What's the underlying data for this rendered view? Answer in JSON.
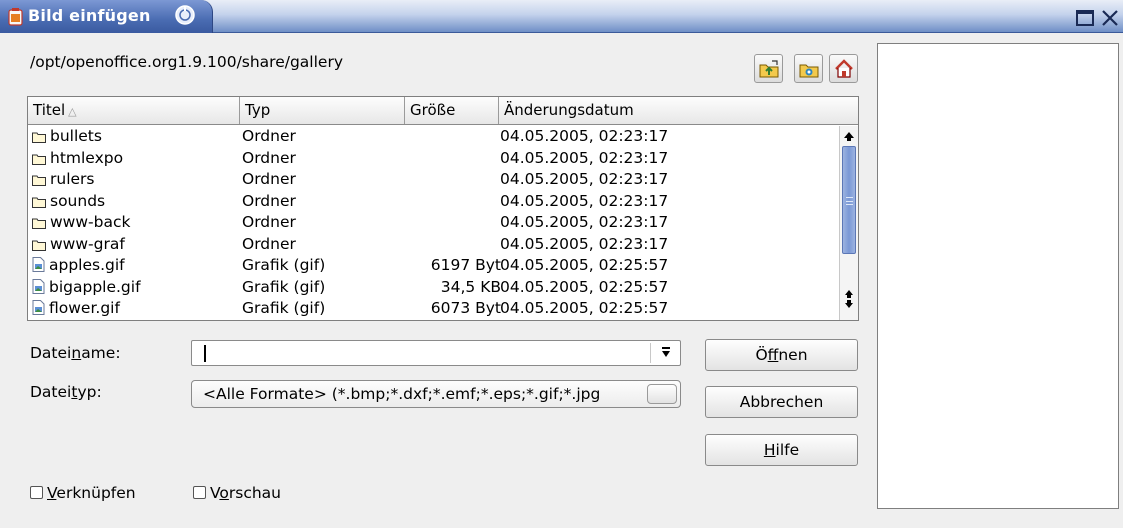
{
  "window": {
    "title": "Bild einfügen"
  },
  "path": "/opt/openoffice.org1.9.100/share/gallery",
  "toolbar": {
    "up_icon": "folder-up-icon",
    "new_folder_icon": "new-folder-icon",
    "home_icon": "home-icon"
  },
  "list": {
    "headers": {
      "title": "Titel",
      "type": "Typ",
      "size": "Größe",
      "date": "Änderungsdatum"
    },
    "rows": [
      {
        "name": "bullets",
        "type": "Ordner",
        "size": "",
        "date": "04.05.2005, 02:23:17",
        "kind": "folder"
      },
      {
        "name": "htmlexpo",
        "type": "Ordner",
        "size": "",
        "date": "04.05.2005, 02:23:17",
        "kind": "folder"
      },
      {
        "name": "rulers",
        "type": "Ordner",
        "size": "",
        "date": "04.05.2005, 02:23:17",
        "kind": "folder"
      },
      {
        "name": "sounds",
        "type": "Ordner",
        "size": "",
        "date": "04.05.2005, 02:23:17",
        "kind": "folder"
      },
      {
        "name": "www-back",
        "type": "Ordner",
        "size": "",
        "date": "04.05.2005, 02:23:17",
        "kind": "folder"
      },
      {
        "name": "www-graf",
        "type": "Ordner",
        "size": "",
        "date": "04.05.2005, 02:23:17",
        "kind": "folder"
      },
      {
        "name": "apples.gif",
        "type": "Grafik (gif)",
        "size": "6197 Byt",
        "date": "04.05.2005, 02:25:57",
        "kind": "file"
      },
      {
        "name": "bigapple.gif",
        "type": "Grafik (gif)",
        "size": "34,5 KB",
        "date": "04.05.2005, 02:25:57",
        "kind": "file"
      },
      {
        "name": "flower.gif",
        "type": "Grafik (gif)",
        "size": "6073 Byt",
        "date": "04.05.2005, 02:25:57",
        "kind": "file"
      }
    ]
  },
  "filename": {
    "label_pre": "Datei",
    "label_mnemonic": "n",
    "label_post": "ame:",
    "value": ""
  },
  "filetype": {
    "label_pre": "Datei",
    "label_mnemonic": "t",
    "label_post": "yp:",
    "value": "<Alle Formate> (*.bmp;*.dxf;*.emf;*.eps;*.gif;*.jpg"
  },
  "buttons": {
    "open": {
      "pre": "Ö",
      "mnemonic": "f",
      "post": "fnen"
    },
    "cancel": "Abbrechen",
    "help": {
      "pre": "",
      "mnemonic": "H",
      "post": "ilfe"
    }
  },
  "checkboxes": {
    "link": {
      "pre": "",
      "mnemonic": "V",
      "post": "erknüpfen",
      "checked": false
    },
    "preview": {
      "pre": "V",
      "mnemonic": "o",
      "post": "rschau",
      "checked": false
    }
  },
  "colors": {
    "titlebar_accent": "#4a6cb2",
    "scroll_thumb": "#7a98d5"
  }
}
